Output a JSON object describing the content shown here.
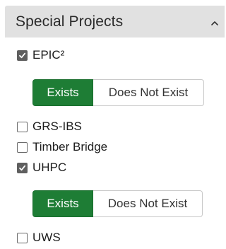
{
  "panel": {
    "title": "Special Projects"
  },
  "options": [
    {
      "label": "EPIC²",
      "checked": true
    },
    {
      "label": "GRS-IBS",
      "checked": false
    },
    {
      "label": "Timber Bridge",
      "checked": false
    },
    {
      "label": "UHPC",
      "checked": true
    },
    {
      "label": "UWS",
      "checked": false
    }
  ],
  "epic_toggle": {
    "exists_label": "Exists",
    "not_exists_label": "Does Not Exist",
    "selected": "Exists"
  },
  "uhpc_toggle": {
    "exists_label": "Exists",
    "not_exists_label": "Does Not Exist",
    "selected": "Exists"
  },
  "colors": {
    "header_bg": "#e1e1e1",
    "active_green": "#1e7d35",
    "checkbox_checked": "#5f5f5f"
  },
  "icons": {
    "collapse": "chevron-up-icon",
    "checked": "checkmark-icon"
  }
}
